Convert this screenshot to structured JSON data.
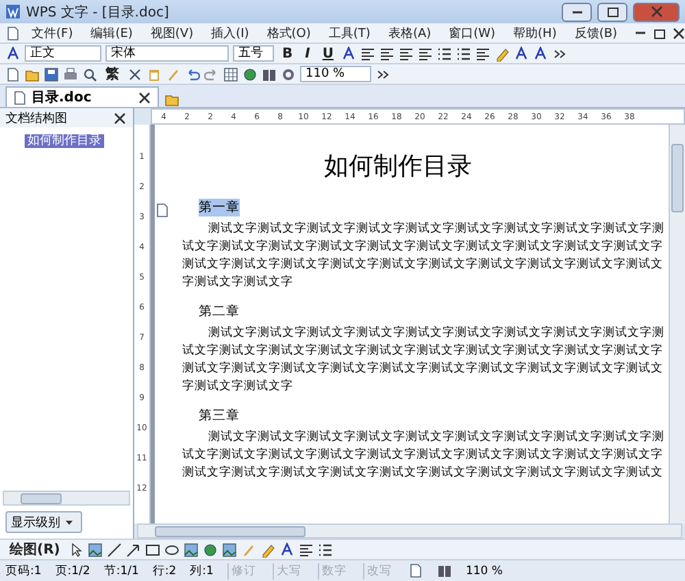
{
  "window": {
    "title": "WPS 文字 - [目录.doc]"
  },
  "menu": [
    "文件(F)",
    "编辑(E)",
    "视图(V)",
    "插入(I)",
    "格式(O)",
    "工具(T)",
    "表格(A)",
    "窗口(W)",
    "帮助(H)",
    "反馈(B)"
  ],
  "format_toolbar": {
    "style": "正文",
    "font": "宋体",
    "size": "五号",
    "buttons": [
      "B",
      "I",
      "U"
    ]
  },
  "standard_toolbar": {
    "convert": "繁",
    "zoom": "110 %"
  },
  "tabs": [
    {
      "label": "目录.doc",
      "selected": true
    }
  ],
  "nav_pane": {
    "title": "文档结构图",
    "items": [
      {
        "label": "如何制作目录",
        "selected": true
      }
    ],
    "level_button": "显示级别"
  },
  "ruler": {
    "marks": [
      "4",
      "2",
      "2",
      "4",
      "6",
      "8",
      "10",
      "12",
      "14",
      "16",
      "18",
      "20",
      "22",
      "24",
      "26",
      "28",
      "30",
      "32",
      "34",
      "36",
      "38"
    ],
    "vertical_marks": [
      "1",
      "2",
      "3",
      "4",
      "5",
      "6",
      "7",
      "8",
      "9",
      "10",
      "11",
      "12"
    ]
  },
  "document": {
    "title": "如何制作目录",
    "sections": [
      {
        "heading": "第一章",
        "selected": true,
        "lines": [
          "测试文字测试文字测试文字测试文字测试文字测试文字测试文字测试文字测试文字测",
          "试文字测试文字测试文字测试文字测试文字测试文字测试文字测试文字测试文字测试文字",
          "测试文字测试文字测试文字测试文字测试文字测试文字测试文字测试文字测试文字测试文",
          "字测试文字测试文字"
        ]
      },
      {
        "heading": "第二章",
        "selected": false,
        "lines": [
          "测试文字测试文字测试文字测试文字测试文字测试文字测试文字测试文字测试文字测",
          "试文字测试文字测试文字测试文字测试文字测试文字测试文字测试文字测试文字测试文字",
          "测试文字测试文字测试文字测试文字测试文字测试文字测试文字测试文字测试文字测试文",
          "字测试文字测试文字"
        ]
      },
      {
        "heading": "第三章",
        "selected": false,
        "lines": [
          "测试文字测试文字测试文字测试文字测试文字测试文字测试文字测试文字测试文字测",
          "试文字测试文字测试文字测试文字测试文字测试文字测试文字测试文字测试文字测试文字",
          "测试文字测试文字测试文字测试文字测试文字测试文字测试文字测试文字测试文字测试文"
        ]
      }
    ]
  },
  "drawing_toolbar": {
    "label": "绘图(R)"
  },
  "status_bar": {
    "items": [
      "页码:1",
      "页:1/2",
      "节:1/1",
      "行:2",
      "列:1"
    ],
    "modes": [
      {
        "label": "修订",
        "on": false
      },
      {
        "label": "大写",
        "on": false
      },
      {
        "label": "数字",
        "on": false
      },
      {
        "label": "改写",
        "on": false
      }
    ],
    "zoom": "110 %"
  }
}
